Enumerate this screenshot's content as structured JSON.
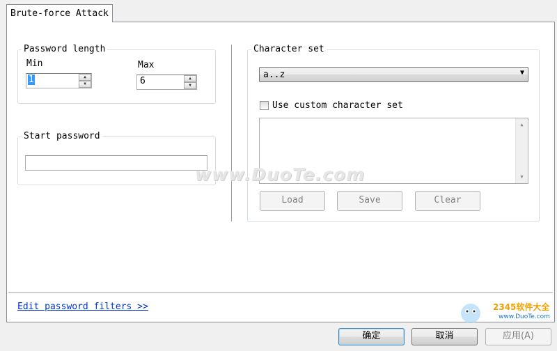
{
  "tab": {
    "label": "Brute-force Attack"
  },
  "password_length": {
    "legend": "Password length",
    "min_label": "Min",
    "min_value": "1",
    "max_label": "Max",
    "max_value": "6"
  },
  "start_password": {
    "legend": "Start password",
    "value": ""
  },
  "charset": {
    "legend": "Character set",
    "selected": "a..z",
    "custom_label": "Use custom character set",
    "custom_checked": false,
    "custom_text": "",
    "buttons": {
      "load": "Load",
      "save": "Save",
      "clear": "Clear"
    }
  },
  "footer": {
    "filters_link": "Edit password filters >>"
  },
  "dialog_buttons": {
    "ok": "确定",
    "cancel": "取消",
    "apply": "应用(A)"
  },
  "watermark": {
    "text": "www.DuoTe.com"
  },
  "corner_logo": {
    "brand": "2345软件大全",
    "url": "www.DuoTe.com"
  }
}
